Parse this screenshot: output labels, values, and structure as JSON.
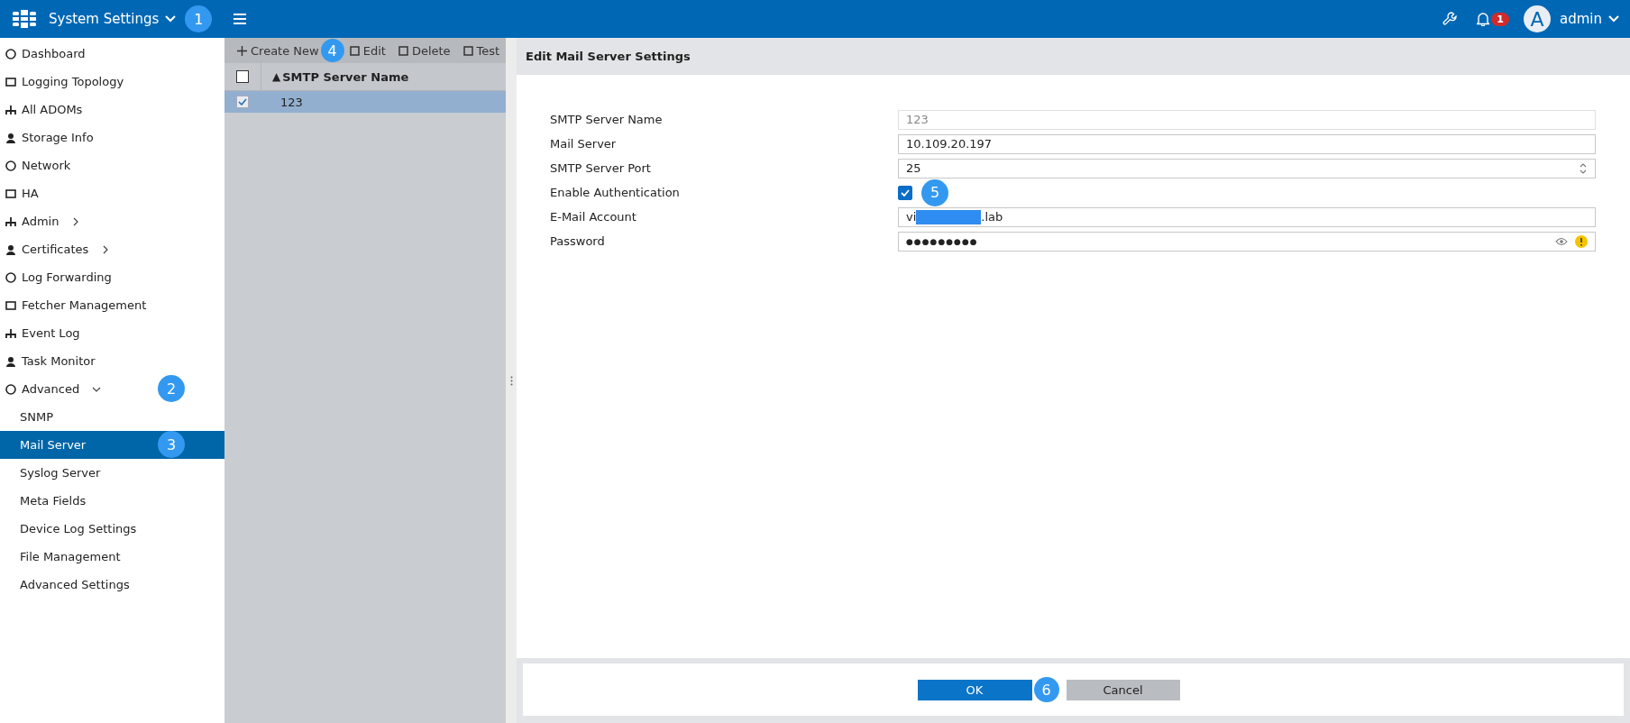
{
  "header": {
    "title": "System Settings",
    "callout": "1",
    "notification_count": "1",
    "avatar_letter": "A",
    "user": "admin"
  },
  "sidebar": {
    "items": [
      {
        "kind": "link",
        "label": "Dashboard"
      },
      {
        "kind": "link",
        "label": "Logging Topology"
      },
      {
        "kind": "link",
        "label": "All ADOMs"
      },
      {
        "kind": "link",
        "label": "Storage Info"
      },
      {
        "kind": "link",
        "label": "Network"
      },
      {
        "kind": "link",
        "label": "HA"
      },
      {
        "kind": "group",
        "label": "Admin",
        "expanded": false
      },
      {
        "kind": "group",
        "label": "Certificates",
        "expanded": false
      },
      {
        "kind": "link",
        "label": "Log Forwarding"
      },
      {
        "kind": "link",
        "label": "Fetcher Management"
      },
      {
        "kind": "link",
        "label": "Event Log"
      },
      {
        "kind": "link",
        "label": "Task Monitor"
      },
      {
        "kind": "group",
        "label": "Advanced",
        "expanded": true,
        "callout": "2",
        "children": [
          {
            "label": "SNMP",
            "selected": false
          },
          {
            "label": "Mail Server",
            "selected": true,
            "callout": "3"
          },
          {
            "label": "Syslog Server",
            "selected": false
          },
          {
            "label": "Meta Fields",
            "selected": false
          },
          {
            "label": "Device Log Settings",
            "selected": false
          },
          {
            "label": "File Management",
            "selected": false
          },
          {
            "label": "Advanced Settings",
            "selected": false
          }
        ]
      }
    ]
  },
  "toolbar": {
    "buttons": [
      {
        "label": "Create New",
        "callout": "4"
      },
      {
        "label": "Edit"
      },
      {
        "label": "Delete"
      },
      {
        "label": "Test"
      }
    ]
  },
  "table": {
    "header_checked": false,
    "columns": [
      {
        "label": "SMTP Server Name",
        "sort_indicator": "▲"
      }
    ],
    "rows": [
      {
        "cells": [
          "123"
        ],
        "checked": true,
        "selected": true
      }
    ]
  },
  "panel": {
    "title": "Edit Mail Server Settings",
    "fields": [
      {
        "kind": "text",
        "label": "SMTP Server Name",
        "value": "123",
        "disabled": true
      },
      {
        "kind": "text",
        "label": "Mail Server",
        "value": "10.109.20.197",
        "disabled": false
      },
      {
        "kind": "number",
        "label": "SMTP Server Port",
        "value": "25",
        "disabled": false
      },
      {
        "kind": "checkbox",
        "label": "Enable Authentication",
        "checked": true,
        "callout": "5"
      },
      {
        "kind": "redacted",
        "label": "E-Mail Account",
        "value_prefix": "vi",
        "value_suffix": ".lab",
        "disabled": false
      },
      {
        "kind": "password",
        "label": "Password",
        "masked_value": "●●●●●●●●●",
        "disabled": false
      }
    ],
    "buttons": [
      {
        "label": "OK",
        "kind": "primary",
        "callout": "6"
      },
      {
        "label": "Cancel",
        "kind": "secondary"
      }
    ]
  }
}
